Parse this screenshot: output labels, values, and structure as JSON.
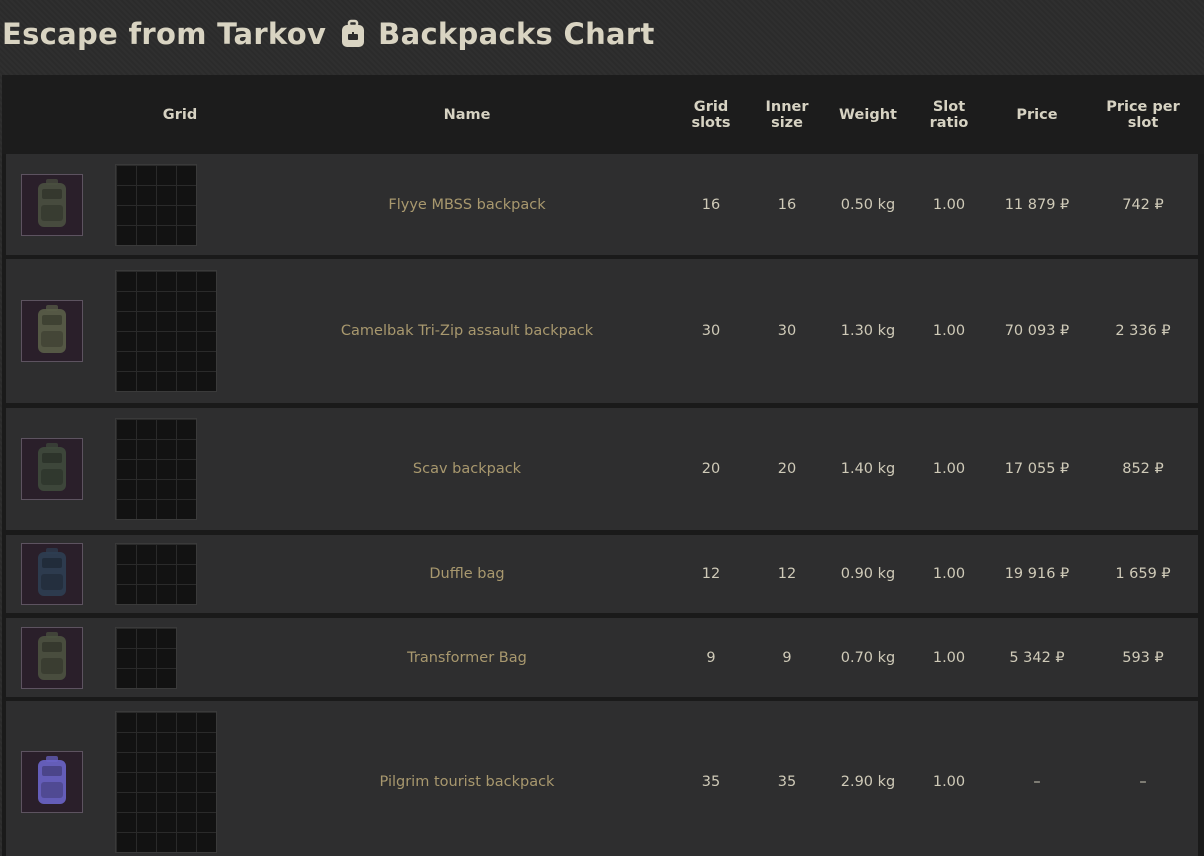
{
  "page": {
    "title_left": "Escape from Tarkov",
    "title_right": "Backpacks Chart",
    "title_icon": "backpack-icon"
  },
  "table": {
    "headers": {
      "grid": "Grid",
      "name": "Name",
      "grid_slots": "Grid slots",
      "inner_size": "Inner size",
      "weight": "Weight",
      "slot_ratio": "Slot ratio",
      "price": "Price",
      "price_per_slot": "Price per slot"
    },
    "rows": [
      {
        "name": "Flyye MBSS backpack",
        "grid_slots": "16",
        "inner_size": "16",
        "weight": "0.50 kg",
        "slot_ratio": "1.00",
        "price": "11 879 ₽",
        "price_per_slot": "742 ₽",
        "icon": "flyye-mbss-backpack-icon",
        "tint": "#4a5040"
      },
      {
        "name": "Camelbak Tri-Zip assault backpack",
        "grid_slots": "30",
        "inner_size": "30",
        "weight": "1.30 kg",
        "slot_ratio": "1.00",
        "price": "70 093 ₽",
        "price_per_slot": "2 336 ₽",
        "icon": "camelbak-tri-zip-backpack-icon",
        "tint": "#5a5e48"
      },
      {
        "name": "Scav backpack",
        "grid_slots": "20",
        "inner_size": "20",
        "weight": "1.40 kg",
        "slot_ratio": "1.00",
        "price": "17 055 ₽",
        "price_per_slot": "852 ₽",
        "icon": "scav-backpack-icon",
        "tint": "#3f4a3c"
      },
      {
        "name": "Duffle bag",
        "grid_slots": "12",
        "inner_size": "12",
        "weight": "0.90 kg",
        "slot_ratio": "1.00",
        "price": "19 916 ₽",
        "price_per_slot": "1 659 ₽",
        "icon": "duffle-bag-icon",
        "tint": "#2e3e52"
      },
      {
        "name": "Transformer Bag",
        "grid_slots": "9",
        "inner_size": "9",
        "weight": "0.70 kg",
        "slot_ratio": "1.00",
        "price": "5 342 ₽",
        "price_per_slot": "593 ₽",
        "icon": "transformer-bag-icon",
        "tint": "#4c5240"
      },
      {
        "name": "Pilgrim tourist backpack",
        "grid_slots": "35",
        "inner_size": "35",
        "weight": "2.90 kg",
        "slot_ratio": "1.00",
        "price": "–",
        "price_per_slot": "–",
        "icon": "pilgrim-tourist-backpack-icon",
        "tint": "#6a64c8"
      }
    ]
  }
}
